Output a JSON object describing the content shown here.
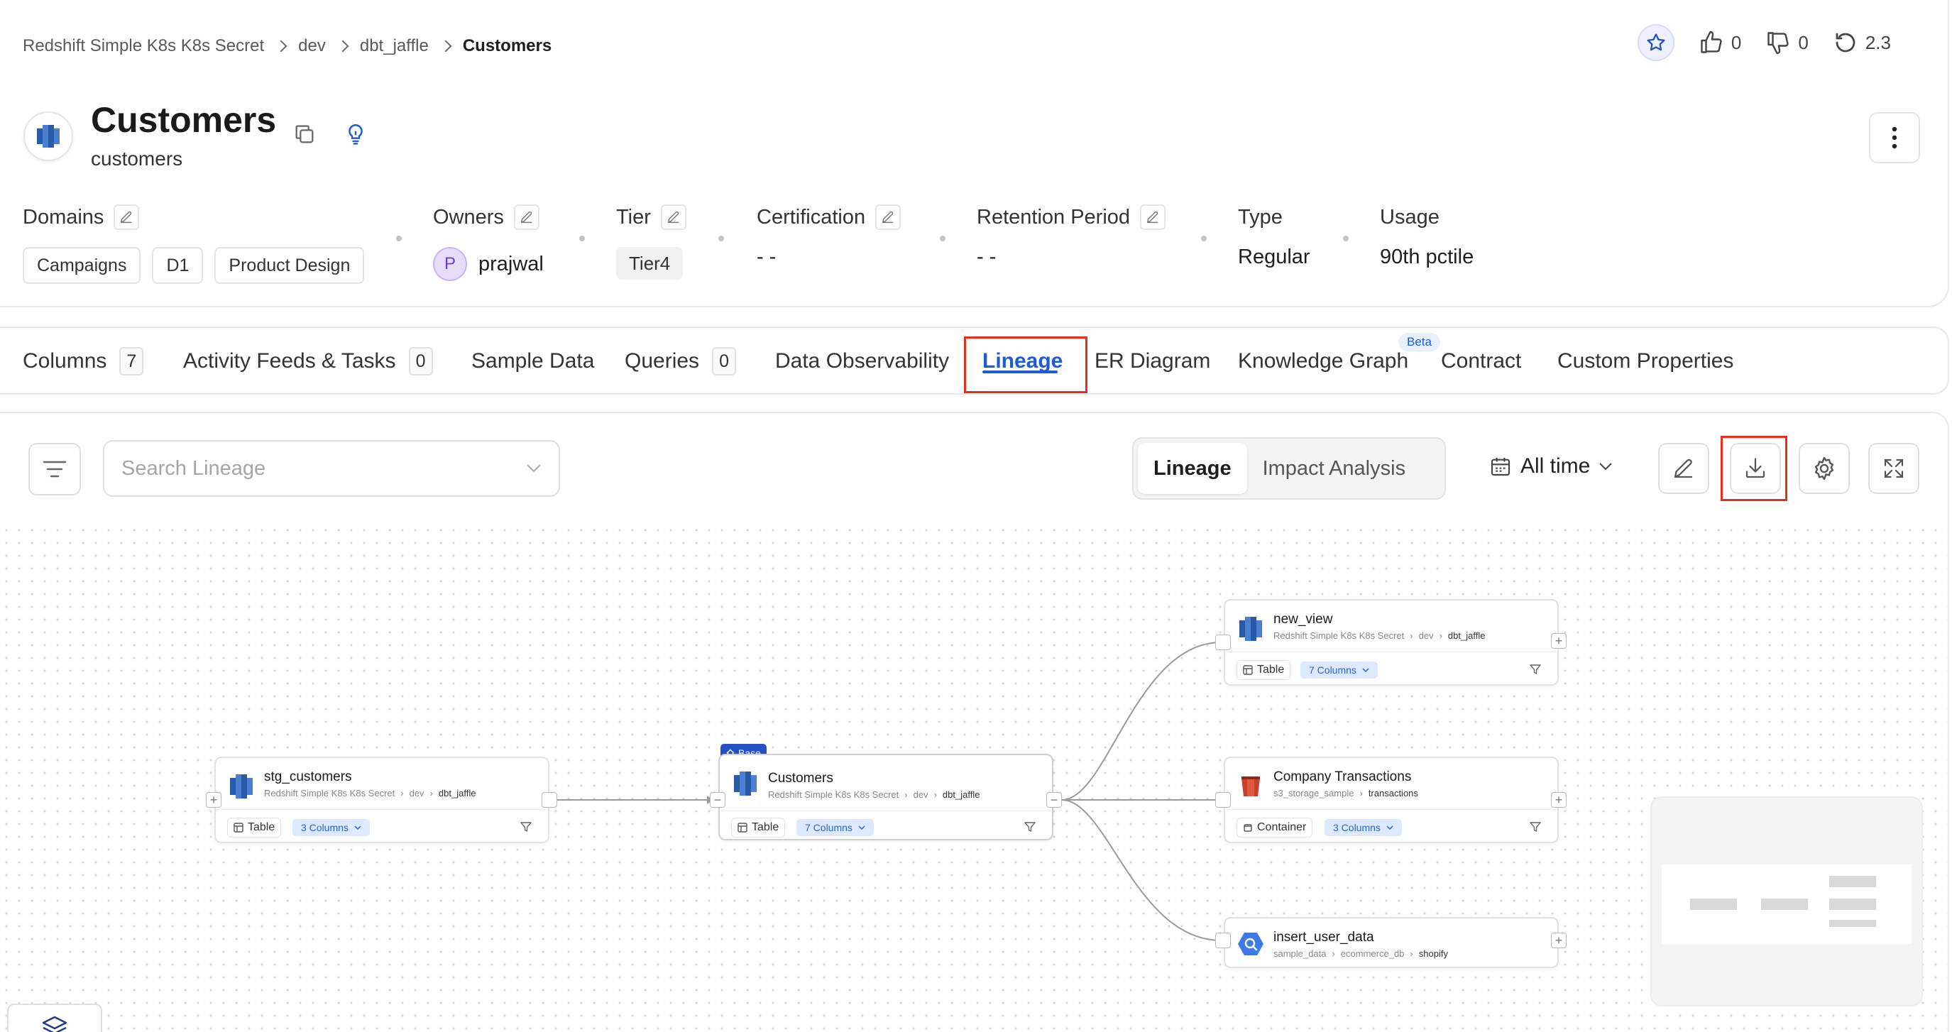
{
  "breadcrumb": {
    "items": [
      "Redshift Simple K8s K8s Secret",
      "dev",
      "dbt_jaffle"
    ],
    "current": "Customers"
  },
  "header": {
    "title": "Customers",
    "subtitle": "customers",
    "likes": "0",
    "dislikes": "0",
    "version": "2.3"
  },
  "meta": {
    "domains_label": "Domains",
    "domains": [
      "Campaigns",
      "D1",
      "Product Design"
    ],
    "owners_label": "Owners",
    "owner_initial": "P",
    "owner_name": "prajwal",
    "tier_label": "Tier",
    "tier_value": "Tier4",
    "certification_label": "Certification",
    "certification_value": "- -",
    "retention_label": "Retention Period",
    "retention_value": "- -",
    "type_label": "Type",
    "type_value": "Regular",
    "usage_label": "Usage",
    "usage_value": "90th pctile"
  },
  "tabs": [
    {
      "label": "Columns",
      "count": "7"
    },
    {
      "label": "Activity Feeds & Tasks",
      "count": "0"
    },
    {
      "label": "Sample Data"
    },
    {
      "label": "Queries",
      "count": "0"
    },
    {
      "label": "Data Observability"
    },
    {
      "label": "Lineage",
      "active": true
    },
    {
      "label": "ER Diagram"
    },
    {
      "label": "Knowledge Graph",
      "badge": "Beta"
    },
    {
      "label": "Contract"
    },
    {
      "label": "Custom Properties"
    }
  ],
  "toolbar": {
    "search_placeholder": "Search Lineage",
    "mode_lineage": "Lineage",
    "mode_impact": "Impact Analysis",
    "time_filter": "All time"
  },
  "nodes": {
    "stg_customers": {
      "name": "stg_customers",
      "path": [
        "Redshift Simple K8s K8s Secret",
        "dev",
        "dbt_jaffle"
      ],
      "type": "Table",
      "columns": "3 Columns"
    },
    "customers": {
      "badge": "Base",
      "name": "Customers",
      "path": [
        "Redshift Simple K8s K8s Secret",
        "dev",
        "dbt_jaffle"
      ],
      "type": "Table",
      "columns": "7 Columns"
    },
    "new_view": {
      "name": "new_view",
      "path": [
        "Redshift Simple K8s K8s Secret",
        "dev",
        "dbt_jaffle"
      ],
      "type": "Table",
      "columns": "7 Columns"
    },
    "company_transactions": {
      "name": "Company Transactions",
      "path": [
        "s3_storage_sample",
        "transactions"
      ],
      "type": "Container",
      "columns": "3 Columns"
    },
    "insert_user_data": {
      "name": "insert_user_data",
      "path": [
        "sample_data",
        "ecommerce_db",
        "shopify"
      ]
    }
  },
  "colors": {
    "accent": "#1e5bd6",
    "highlight": "#e0301e",
    "base_badge": "#2450c4"
  }
}
